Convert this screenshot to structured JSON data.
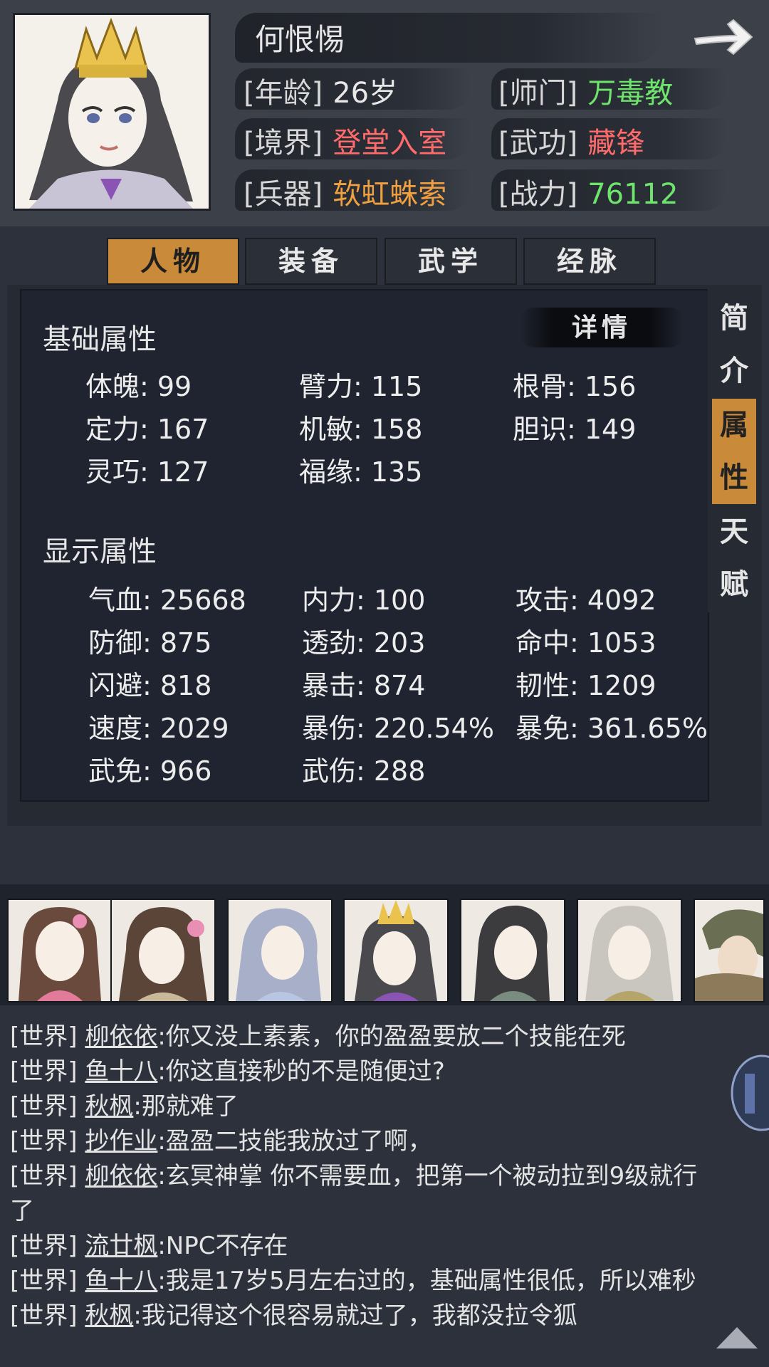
{
  "character": {
    "name": "何恨惕",
    "info": [
      {
        "label": "[年龄]",
        "value": "26岁",
        "color": "#e8e8e8"
      },
      {
        "label": "[师门]",
        "value": "万毒教",
        "color": "#6ee46c"
      },
      {
        "label": "[境界]",
        "value": "登堂入室",
        "color": "#ff6b6b"
      },
      {
        "label": "[武功]",
        "value": "藏锋",
        "color": "#ff6b6b"
      },
      {
        "label": "[兵器]",
        "value": "软虹蛛索",
        "color": "#f0a040"
      },
      {
        "label": "[战力]",
        "value": "76112",
        "color": "#6ee46c"
      }
    ]
  },
  "tabs": [
    {
      "label": "人物",
      "active": true
    },
    {
      "label": "装备",
      "active": false
    },
    {
      "label": "武学",
      "active": false
    },
    {
      "label": "经脉",
      "active": false
    }
  ],
  "side_tabs": [
    {
      "chars": [
        "简",
        "介"
      ],
      "active": false
    },
    {
      "chars": [
        "属",
        "性"
      ],
      "active": true
    },
    {
      "chars": [
        "天",
        "赋"
      ],
      "active": false
    }
  ],
  "details_label": "详情",
  "base_section": {
    "title": "基础属性",
    "stats": [
      "体魄: 99",
      "臂力: 115",
      "根骨: 156",
      "定力: 167",
      "机敏: 158",
      "胆识: 149",
      "灵巧: 127",
      "福缘: 135"
    ]
  },
  "display_section": {
    "title": "显示属性",
    "stats": [
      "气血: 25668",
      "内力: 100",
      "攻击: 4092",
      "防御: 875",
      "透劲: 203",
      "命中: 1053",
      "闪避: 818",
      "暴击: 874",
      "韧性: 1209",
      "速度: 2029",
      "暴伤: 220.54%",
      "暴免: 361.65%",
      "武免: 966",
      "武伤: 288"
    ]
  },
  "chat": [
    {
      "channel": "[世界]",
      "sender": "柳依依",
      "text": ":你又没上素素，你的盈盈要放二个技能在死"
    },
    {
      "channel": "[世界]",
      "sender": "鱼十八",
      "text": ":你这直接秒的不是随便过?"
    },
    {
      "channel": "[世界]",
      "sender": "秋枫",
      "text": ":那就难了"
    },
    {
      "channel": "[世界]",
      "sender": "抄作业",
      "text": ":盈盈二技能我放过了啊，"
    },
    {
      "channel": "[世界]",
      "sender": "柳依依",
      "text": ":玄冥神掌 你不需要血，把第一个被动拉到9级就行"
    },
    {
      "channel": "",
      "sender": "",
      "text": "了"
    },
    {
      "channel": "[世界]",
      "sender": "流廿枫",
      "text": ":NPC不存在"
    },
    {
      "channel": "[世界]",
      "sender": "鱼十八",
      "text": ":我是17岁5月左右过的，基础属性很低，所以难秒"
    },
    {
      "channel": "[世界]",
      "sender": "秋枫",
      "text": ":我记得这个很容易就过了，我都没拉令狐"
    }
  ],
  "colors": {
    "accent": "#c98a3a",
    "green": "#6ee46c",
    "red": "#ff6b6b",
    "orange": "#f0a040"
  }
}
